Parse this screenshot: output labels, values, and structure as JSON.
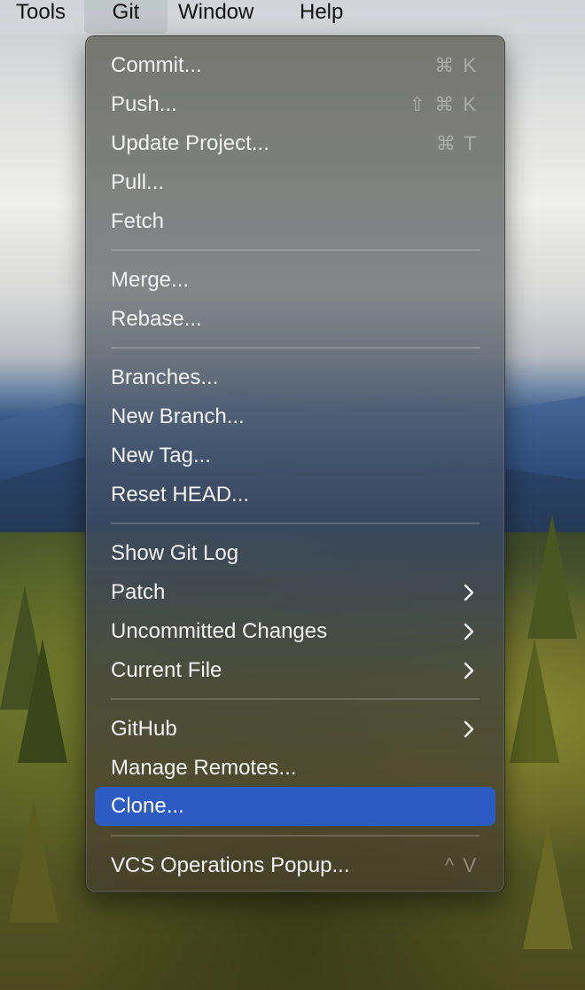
{
  "menubar": {
    "items": [
      {
        "label": "Tools"
      },
      {
        "label": "Git"
      },
      {
        "label": "Window"
      },
      {
        "label": "Help"
      }
    ]
  },
  "menu": {
    "items": [
      {
        "label": "Commit...",
        "shortcut": "⌘ K"
      },
      {
        "label": "Push...",
        "shortcut": "⇧ ⌘ K"
      },
      {
        "label": "Update Project...",
        "shortcut": "⌘ T"
      },
      {
        "label": "Pull..."
      },
      {
        "label": "Fetch"
      },
      {
        "label": "Merge..."
      },
      {
        "label": "Rebase..."
      },
      {
        "label": "Branches..."
      },
      {
        "label": "New Branch..."
      },
      {
        "label": "New Tag..."
      },
      {
        "label": "Reset HEAD..."
      },
      {
        "label": "Show Git Log"
      },
      {
        "label": "Patch",
        "submenu": true
      },
      {
        "label": "Uncommitted Changes",
        "submenu": true
      },
      {
        "label": "Current File",
        "submenu": true
      },
      {
        "label": "GitHub",
        "submenu": true
      },
      {
        "label": "Manage Remotes..."
      },
      {
        "label": "Clone...",
        "selected": true
      },
      {
        "label": "VCS Operations Popup...",
        "shortcut": "^ V"
      }
    ]
  },
  "icons": {
    "submenu": "chevron-right-icon"
  },
  "colors": {
    "selection": "#2d5bc4"
  }
}
